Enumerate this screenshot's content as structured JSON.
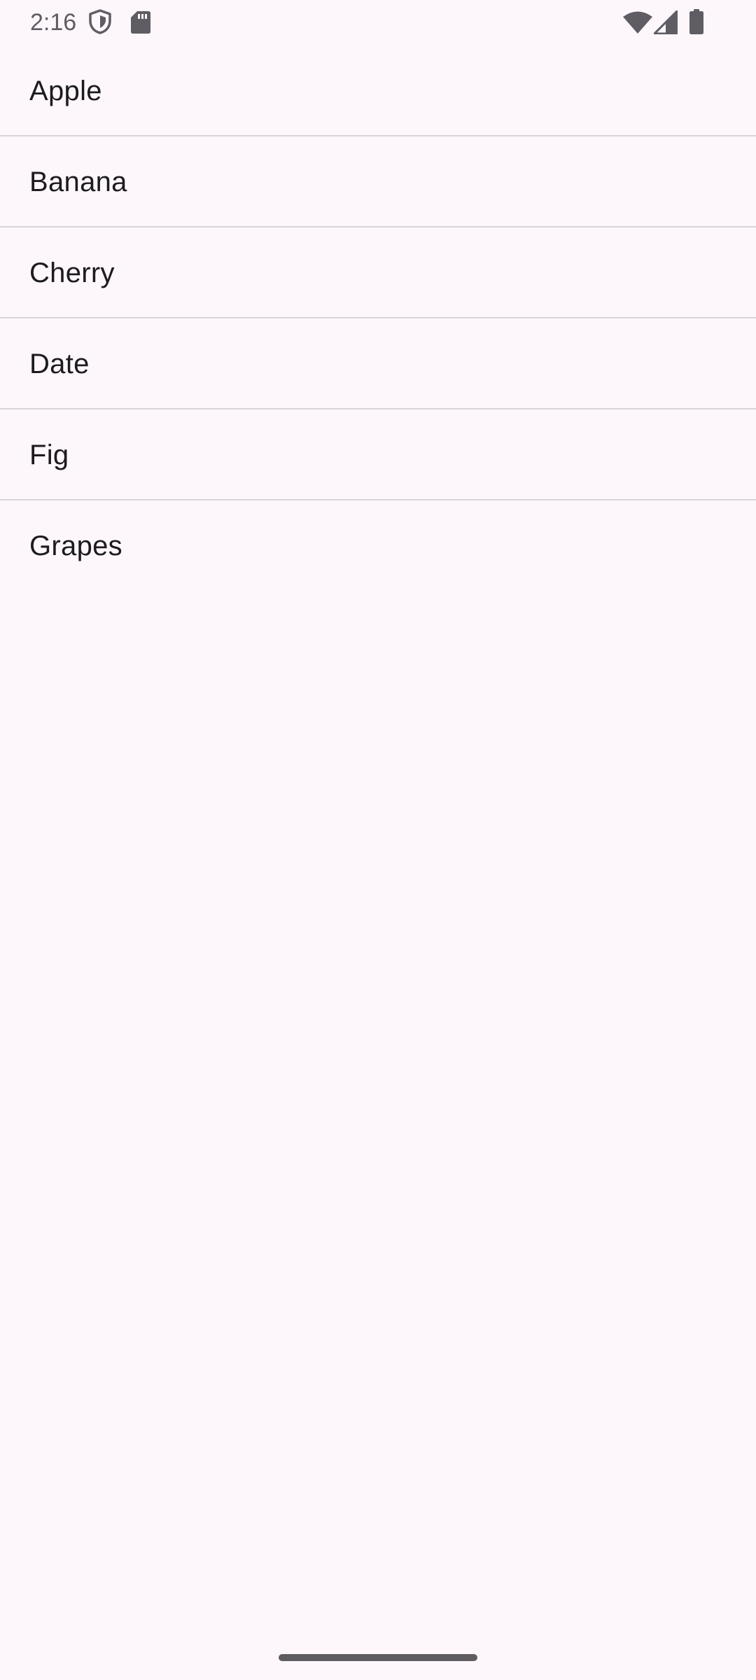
{
  "status_bar": {
    "time": "2:16",
    "left_icons": [
      "shield-icon",
      "sd-card-icon"
    ],
    "right_icons": [
      "wifi-icon",
      "cellular-signal-icon",
      "battery-icon"
    ],
    "icon_color": "#5F5C63"
  },
  "list": {
    "items": [
      {
        "label": "Apple"
      },
      {
        "label": "Banana"
      },
      {
        "label": "Cherry"
      },
      {
        "label": "Date"
      },
      {
        "label": "Fig"
      },
      {
        "label": "Grapes"
      }
    ]
  },
  "colors": {
    "background": "#FDF7FC",
    "text": "#1D1B20",
    "divider": "#D9D4DA"
  }
}
